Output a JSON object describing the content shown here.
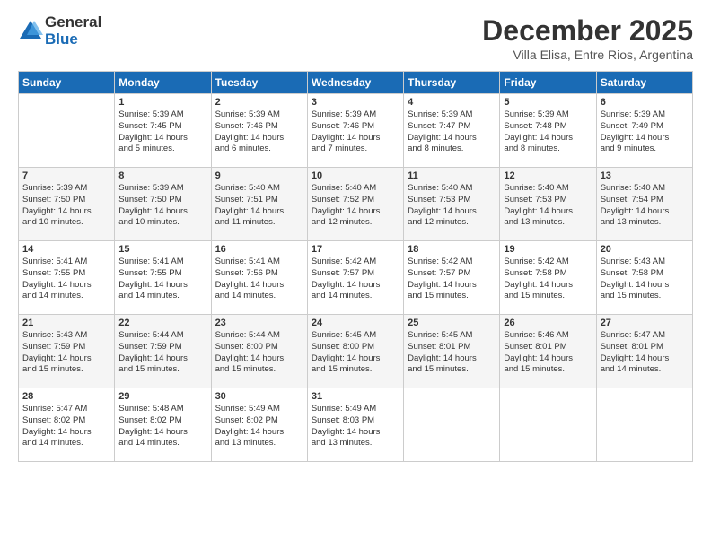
{
  "logo": {
    "general": "General",
    "blue": "Blue"
  },
  "title": "December 2025",
  "subtitle": "Villa Elisa, Entre Rios, Argentina",
  "calendar": {
    "headers": [
      "Sunday",
      "Monday",
      "Tuesday",
      "Wednesday",
      "Thursday",
      "Friday",
      "Saturday"
    ],
    "weeks": [
      [
        {
          "day": "",
          "info": ""
        },
        {
          "day": "1",
          "info": "Sunrise: 5:39 AM\nSunset: 7:45 PM\nDaylight: 14 hours\nand 5 minutes."
        },
        {
          "day": "2",
          "info": "Sunrise: 5:39 AM\nSunset: 7:46 PM\nDaylight: 14 hours\nand 6 minutes."
        },
        {
          "day": "3",
          "info": "Sunrise: 5:39 AM\nSunset: 7:46 PM\nDaylight: 14 hours\nand 7 minutes."
        },
        {
          "day": "4",
          "info": "Sunrise: 5:39 AM\nSunset: 7:47 PM\nDaylight: 14 hours\nand 8 minutes."
        },
        {
          "day": "5",
          "info": "Sunrise: 5:39 AM\nSunset: 7:48 PM\nDaylight: 14 hours\nand 8 minutes."
        },
        {
          "day": "6",
          "info": "Sunrise: 5:39 AM\nSunset: 7:49 PM\nDaylight: 14 hours\nand 9 minutes."
        }
      ],
      [
        {
          "day": "7",
          "info": "Sunrise: 5:39 AM\nSunset: 7:50 PM\nDaylight: 14 hours\nand 10 minutes."
        },
        {
          "day": "8",
          "info": "Sunrise: 5:39 AM\nSunset: 7:50 PM\nDaylight: 14 hours\nand 10 minutes."
        },
        {
          "day": "9",
          "info": "Sunrise: 5:40 AM\nSunset: 7:51 PM\nDaylight: 14 hours\nand 11 minutes."
        },
        {
          "day": "10",
          "info": "Sunrise: 5:40 AM\nSunset: 7:52 PM\nDaylight: 14 hours\nand 12 minutes."
        },
        {
          "day": "11",
          "info": "Sunrise: 5:40 AM\nSunset: 7:53 PM\nDaylight: 14 hours\nand 12 minutes."
        },
        {
          "day": "12",
          "info": "Sunrise: 5:40 AM\nSunset: 7:53 PM\nDaylight: 14 hours\nand 13 minutes."
        },
        {
          "day": "13",
          "info": "Sunrise: 5:40 AM\nSunset: 7:54 PM\nDaylight: 14 hours\nand 13 minutes."
        }
      ],
      [
        {
          "day": "14",
          "info": "Sunrise: 5:41 AM\nSunset: 7:55 PM\nDaylight: 14 hours\nand 14 minutes."
        },
        {
          "day": "15",
          "info": "Sunrise: 5:41 AM\nSunset: 7:55 PM\nDaylight: 14 hours\nand 14 minutes."
        },
        {
          "day": "16",
          "info": "Sunrise: 5:41 AM\nSunset: 7:56 PM\nDaylight: 14 hours\nand 14 minutes."
        },
        {
          "day": "17",
          "info": "Sunrise: 5:42 AM\nSunset: 7:57 PM\nDaylight: 14 hours\nand 14 minutes."
        },
        {
          "day": "18",
          "info": "Sunrise: 5:42 AM\nSunset: 7:57 PM\nDaylight: 14 hours\nand 15 minutes."
        },
        {
          "day": "19",
          "info": "Sunrise: 5:42 AM\nSunset: 7:58 PM\nDaylight: 14 hours\nand 15 minutes."
        },
        {
          "day": "20",
          "info": "Sunrise: 5:43 AM\nSunset: 7:58 PM\nDaylight: 14 hours\nand 15 minutes."
        }
      ],
      [
        {
          "day": "21",
          "info": "Sunrise: 5:43 AM\nSunset: 7:59 PM\nDaylight: 14 hours\nand 15 minutes."
        },
        {
          "day": "22",
          "info": "Sunrise: 5:44 AM\nSunset: 7:59 PM\nDaylight: 14 hours\nand 15 minutes."
        },
        {
          "day": "23",
          "info": "Sunrise: 5:44 AM\nSunset: 8:00 PM\nDaylight: 14 hours\nand 15 minutes."
        },
        {
          "day": "24",
          "info": "Sunrise: 5:45 AM\nSunset: 8:00 PM\nDaylight: 14 hours\nand 15 minutes."
        },
        {
          "day": "25",
          "info": "Sunrise: 5:45 AM\nSunset: 8:01 PM\nDaylight: 14 hours\nand 15 minutes."
        },
        {
          "day": "26",
          "info": "Sunrise: 5:46 AM\nSunset: 8:01 PM\nDaylight: 14 hours\nand 15 minutes."
        },
        {
          "day": "27",
          "info": "Sunrise: 5:47 AM\nSunset: 8:01 PM\nDaylight: 14 hours\nand 14 minutes."
        }
      ],
      [
        {
          "day": "28",
          "info": "Sunrise: 5:47 AM\nSunset: 8:02 PM\nDaylight: 14 hours\nand 14 minutes."
        },
        {
          "day": "29",
          "info": "Sunrise: 5:48 AM\nSunset: 8:02 PM\nDaylight: 14 hours\nand 14 minutes."
        },
        {
          "day": "30",
          "info": "Sunrise: 5:49 AM\nSunset: 8:02 PM\nDaylight: 14 hours\nand 13 minutes."
        },
        {
          "day": "31",
          "info": "Sunrise: 5:49 AM\nSunset: 8:03 PM\nDaylight: 14 hours\nand 13 minutes."
        },
        {
          "day": "",
          "info": ""
        },
        {
          "day": "",
          "info": ""
        },
        {
          "day": "",
          "info": ""
        }
      ]
    ]
  }
}
